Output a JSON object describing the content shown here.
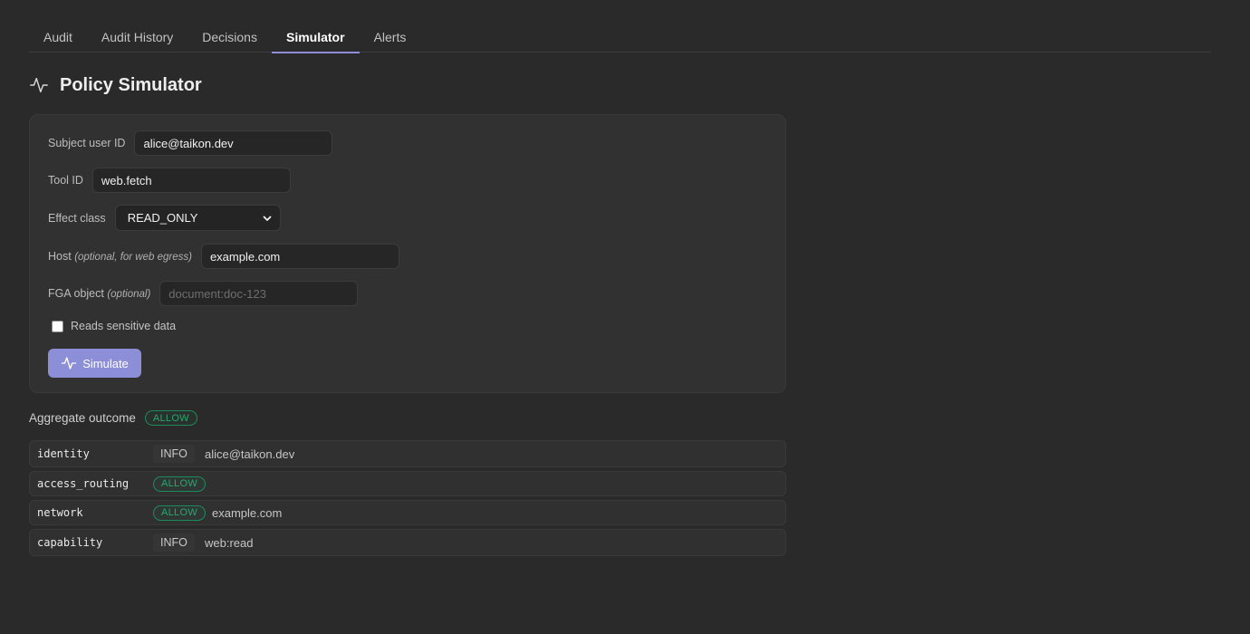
{
  "tabs": [
    {
      "label": "Audit"
    },
    {
      "label": "Audit History"
    },
    {
      "label": "Decisions"
    },
    {
      "label": "Simulator",
      "active": true
    },
    {
      "label": "Alerts"
    }
  ],
  "page": {
    "title": "Policy Simulator",
    "icon": "activity-icon"
  },
  "form": {
    "subject_label": "Subject user ID",
    "subject_value": "alice@taikon.dev",
    "tool_label": "Tool ID",
    "tool_value": "web.fetch",
    "effect_label": "Effect class",
    "effect_value": "READ_ONLY",
    "host_label": "Host",
    "host_hint": "(optional, for web egress)",
    "host_value": "example.com",
    "fga_label": "FGA object",
    "fga_hint": "(optional)",
    "fga_value": "",
    "fga_placeholder": "document:doc-123",
    "sensitive_label": "Reads sensitive data",
    "sensitive_checked": false,
    "simulate_label": "Simulate"
  },
  "aggregate": {
    "label": "Aggregate outcome",
    "outcome": "ALLOW"
  },
  "results": [
    {
      "name": "identity",
      "badge": "INFO",
      "detail": "alice@taikon.dev"
    },
    {
      "name": "access_routing",
      "badge": "ALLOW",
      "detail": ""
    },
    {
      "name": "network",
      "badge": "ALLOW",
      "detail": "example.com"
    },
    {
      "name": "capability",
      "badge": "INFO",
      "detail": "web:read"
    }
  ],
  "colors": {
    "accent": "#8c8ed8",
    "allow": "#2aa76e",
    "background": "#2a2a2a"
  }
}
